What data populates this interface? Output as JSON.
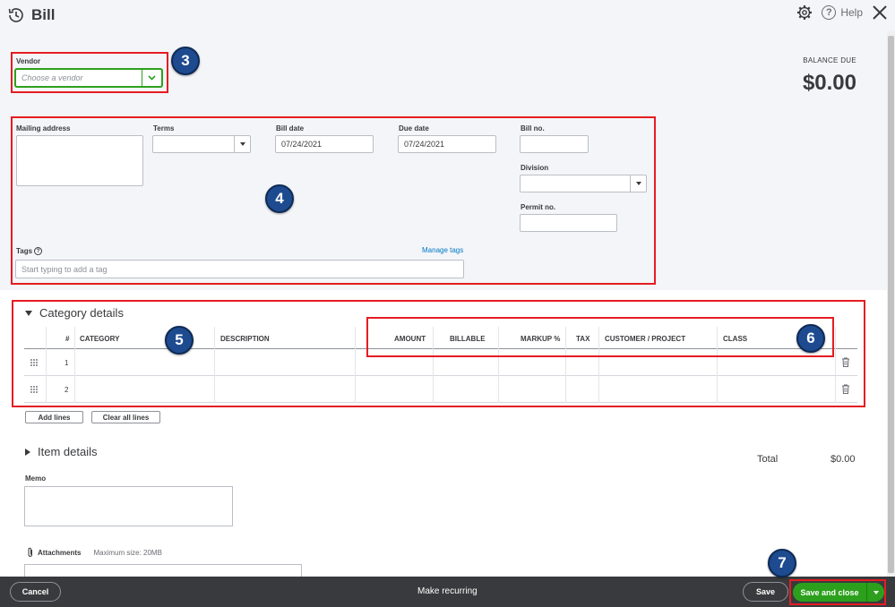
{
  "header": {
    "title": "Bill",
    "help_label": "Help"
  },
  "vendor": {
    "label": "Vendor",
    "placeholder": "Choose a vendor"
  },
  "balance": {
    "label": "BALANCE DUE",
    "amount": "$0.00"
  },
  "form": {
    "mailing_address_label": "Mailing address",
    "terms_label": "Terms",
    "bill_date_label": "Bill date",
    "bill_date_value": "07/24/2021",
    "due_date_label": "Due date",
    "due_date_value": "07/24/2021",
    "bill_no_label": "Bill no.",
    "division_label": "Division",
    "permit_no_label": "Permit no.",
    "tags_label": "Tags",
    "tags_placeholder": "Start typing to add a tag",
    "manage_tags": "Manage tags"
  },
  "category": {
    "title": "Category details",
    "columns": [
      "#",
      "CATEGORY",
      "DESCRIPTION",
      "AMOUNT",
      "BILLABLE",
      "MARKUP %",
      "TAX",
      "CUSTOMER / PROJECT",
      "CLASS"
    ],
    "rows": [
      "1",
      "2"
    ],
    "add_lines": "Add lines",
    "clear_lines": "Clear all lines"
  },
  "items": {
    "title": "Item details"
  },
  "total": {
    "label": "Total",
    "value": "$0.00"
  },
  "memo": {
    "label": "Memo"
  },
  "attachments": {
    "label": "Attachments",
    "max_size": "Maximum size: 20MB"
  },
  "footer": {
    "cancel": "Cancel",
    "recurring": "Make recurring",
    "save": "Save",
    "save_close": "Save and close"
  },
  "annotations": [
    "3",
    "4",
    "5",
    "6",
    "7"
  ],
  "colors": {
    "accent_green": "#2ca01c",
    "annotation_red": "#e51c23",
    "badge_blue": "#1e4b8f",
    "footer_bg": "#393a3d"
  }
}
